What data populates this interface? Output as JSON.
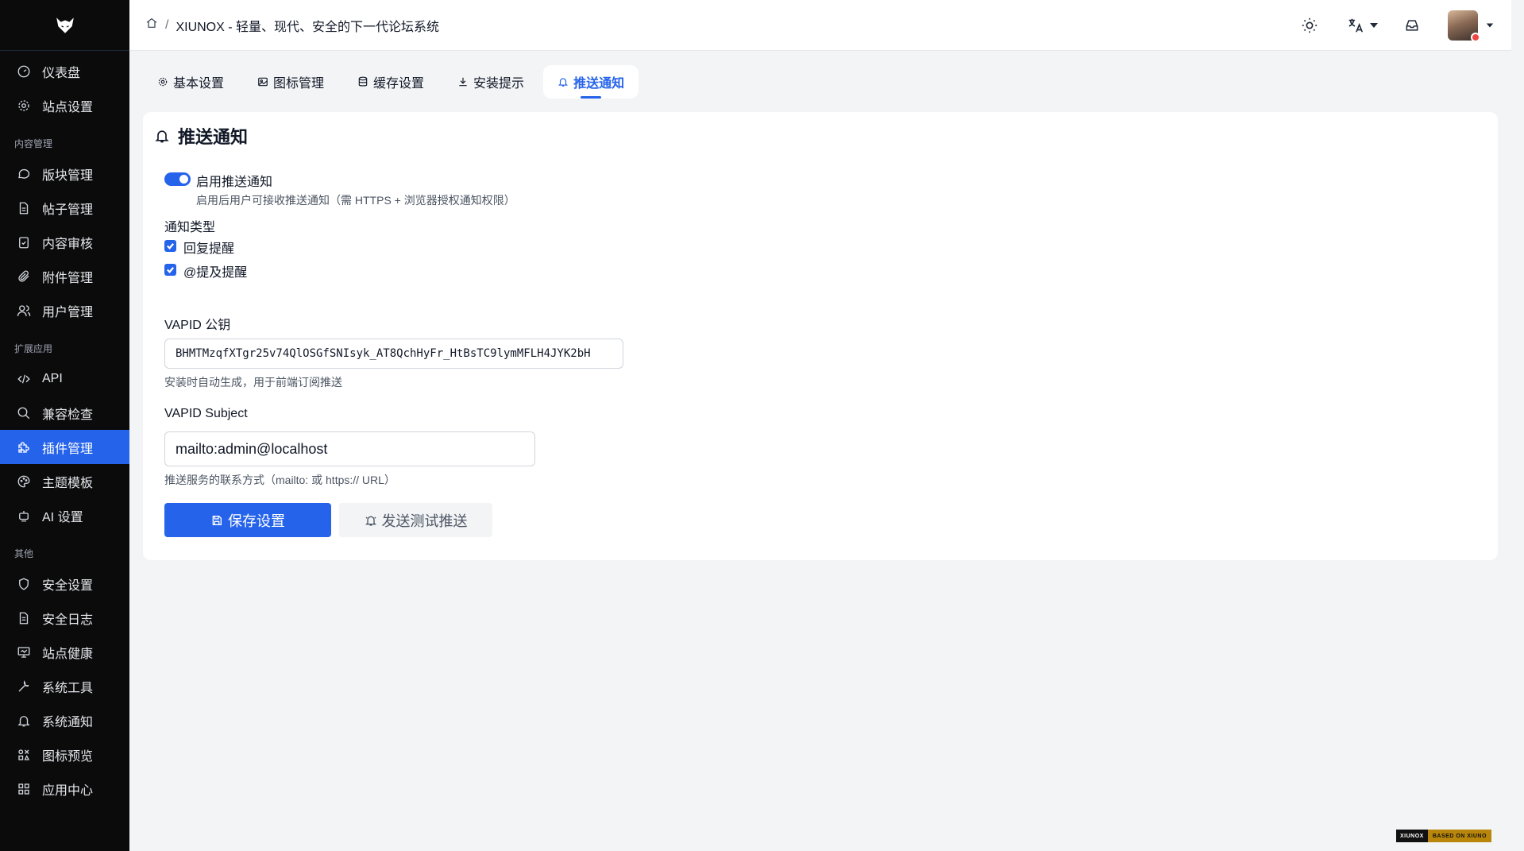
{
  "sidebar": {
    "items": [
      {
        "label": "仪表盘",
        "icon": "gauge-icon"
      },
      {
        "label": "站点设置",
        "icon": "gear-icon"
      }
    ],
    "section_content": "内容管理",
    "content_items": [
      {
        "label": "版块管理",
        "icon": "chat-bubble-icon"
      },
      {
        "label": "帖子管理",
        "icon": "document-icon"
      },
      {
        "label": "内容审核",
        "icon": "clipboard-check-icon"
      },
      {
        "label": "附件管理",
        "icon": "paperclip-icon"
      },
      {
        "label": "用户管理",
        "icon": "users-icon"
      }
    ],
    "section_ext": "扩展应用",
    "ext_items": [
      {
        "label": "API",
        "icon": "code-icon"
      },
      {
        "label": "兼容检查",
        "icon": "search-icon"
      },
      {
        "label": "插件管理",
        "icon": "puzzle-icon",
        "active": true
      },
      {
        "label": "主题模板",
        "icon": "palette-icon"
      },
      {
        "label": "AI 设置",
        "icon": "robot-icon"
      }
    ],
    "section_other": "其他",
    "other_items": [
      {
        "label": "安全设置",
        "icon": "shield-icon"
      },
      {
        "label": "安全日志",
        "icon": "log-icon"
      },
      {
        "label": "站点健康",
        "icon": "monitor-icon"
      },
      {
        "label": "系统工具",
        "icon": "wrench-icon"
      },
      {
        "label": "系统通知",
        "icon": "bell-icon"
      },
      {
        "label": "图标预览",
        "icon": "shapes-icon"
      },
      {
        "label": "应用中心",
        "icon": "grid-icon"
      }
    ]
  },
  "header": {
    "breadcrumb_sep": "/",
    "title": "XIUNOX - 轻量、现代、安全的下一代论坛系统"
  },
  "tabs": [
    {
      "label": "基本设置",
      "icon": "gear-icon"
    },
    {
      "label": "图标管理",
      "icon": "image-icon"
    },
    {
      "label": "缓存设置",
      "icon": "database-icon"
    },
    {
      "label": "安装提示",
      "icon": "download-icon"
    },
    {
      "label": "推送通知",
      "icon": "bell-icon",
      "active": true
    }
  ],
  "card": {
    "title": "推送通知",
    "toggle_label": "启用推送通知",
    "toggle_on": true,
    "toggle_desc": "启用后用户可接收推送通知（需 HTTPS + 浏览器授权通知权限）",
    "types_label": "通知类型",
    "type_reply": "回复提醒",
    "type_reply_checked": true,
    "type_mention": "@提及提醒",
    "type_mention_checked": true,
    "vapid_key_label": "VAPID 公钥",
    "vapid_key_value": "BHMTMzqfXTgr25v74QlOSGfSNIsyk_AT8QchHyFr_HtBsTC9lymMFLH4JYK2bH",
    "vapid_key_hint": "安装时自动生成，用于前端订阅推送",
    "vapid_subject_label": "VAPID Subject",
    "vapid_subject_value": "mailto:admin@localhost",
    "vapid_subject_hint": "推送服务的联系方式（mailto: 或 https:// URL）",
    "save_button": "保存设置",
    "test_button": "发送测试推送"
  },
  "footer_badge": {
    "left": "XIUNOX",
    "right": "BASED ON XIUNO"
  },
  "colors": {
    "accent": "#2563eb",
    "sidebar_bg": "#0b0b0c",
    "page_bg": "#f3f4f6"
  }
}
